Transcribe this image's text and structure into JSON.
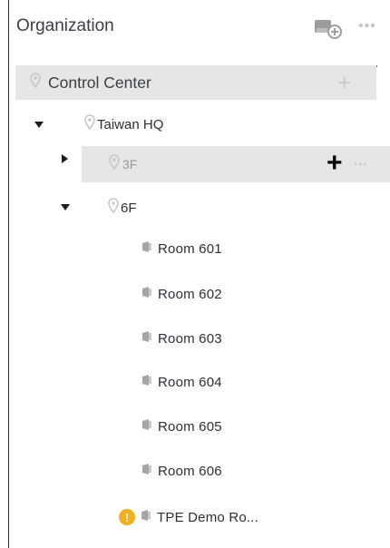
{
  "panel": {
    "title": "Organization",
    "add_site_icon": "add-site-icon",
    "more_icon": "more-icon",
    "more_glyph": "•••"
  },
  "tree": {
    "root": {
      "label": "Control Center",
      "add_glyph": "+"
    },
    "site": {
      "label": "Taiwan HQ"
    },
    "floor3": {
      "label": "3F",
      "add_glyph": "+",
      "more_glyph": "•••"
    },
    "floor6": {
      "label": "6F"
    },
    "rooms": [
      {
        "label": "Room 601"
      },
      {
        "label": "Room 602"
      },
      {
        "label": "Room 603"
      },
      {
        "label": "Room 604"
      },
      {
        "label": "Room 605"
      },
      {
        "label": "Room 606"
      }
    ],
    "demo_room": {
      "label": "TPE Demo Ro...",
      "alert_glyph": "!"
    }
  },
  "colors": {
    "accent_line": "#4a6f9a",
    "pin_gray": "#c9c9c9",
    "alert": "#f2b01e"
  }
}
